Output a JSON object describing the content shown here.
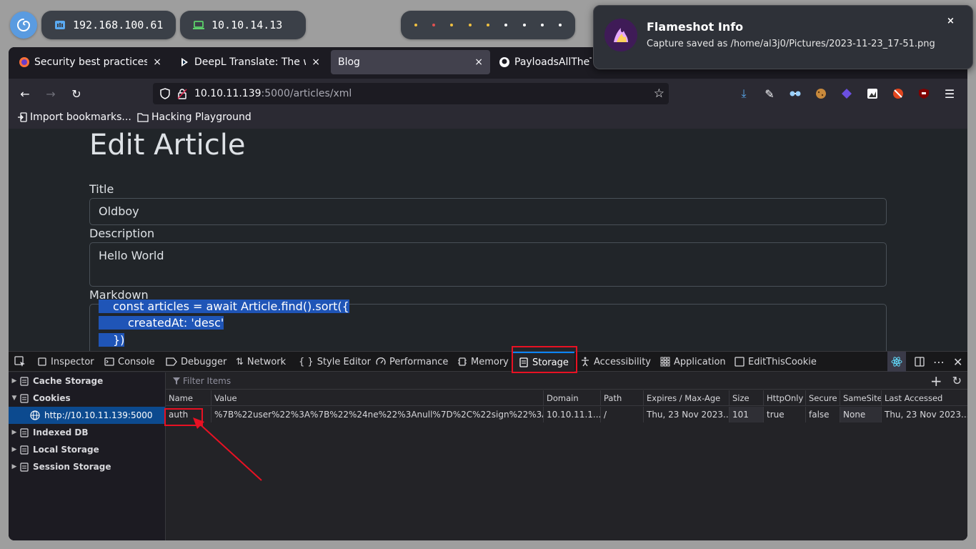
{
  "desktop": {
    "ip_pill_1": "192.168.100.61",
    "ip_pill_2": "10.10.14.13"
  },
  "browser": {
    "tabs": [
      {
        "label": "Security best practices |",
        "close": "×"
      },
      {
        "label": "DeepL Translate: The wo",
        "close": "×"
      },
      {
        "label": "Blog",
        "close": "×"
      },
      {
        "label": "PayloadsAllTheTh"
      }
    ],
    "url_host": "10.10.11.139",
    "url_path": ":5000/articles/xml",
    "bookmarks": [
      "Import bookmarks...",
      "Hacking Playground"
    ]
  },
  "page": {
    "heading": "Edit Article",
    "title_label": "Title",
    "title_value": "Oldboy",
    "description_label": "Description",
    "description_value": "Hello World",
    "markdown_label": "Markdown",
    "markdown_lines": [
      "const articles = await Article.find().sort({",
      "createdAt: 'desc'",
      "})"
    ]
  },
  "devtools": {
    "tabs": [
      "Inspector",
      "Console",
      "Debugger",
      "Network",
      "Style Editor",
      "Performance",
      "Memory",
      "Storage",
      "Accessibility",
      "Application",
      "EditThisCookie"
    ],
    "sidebar": [
      "Cache Storage",
      "Cookies",
      "http://10.10.11.139:5000",
      "Indexed DB",
      "Local Storage",
      "Session Storage"
    ],
    "filter_placeholder": "Filter Items",
    "columns": [
      "Name",
      "Value",
      "Domain",
      "Path",
      "Expires / Max-Age",
      "Size",
      "HttpOnly",
      "Secure",
      "SameSite",
      "Last Accessed"
    ],
    "row": [
      "auth",
      "%7B%22user%22%3A%7B%22%24ne%22%3Anull%7D%2C%22sign%22%3A%...",
      "10.10.11.1...",
      "/",
      "Thu, 23 Nov 2023...",
      "101",
      "true",
      "false",
      "None",
      "Thu, 23 Nov 2023..."
    ]
  },
  "notification": {
    "title": "Flameshot Info",
    "body": "Capture saved as /home/al3j0/Pictures/2023-11-23_17-51.png",
    "close": "×"
  },
  "colors": {
    "highlight": "#e81123",
    "selection": "#1f55b7",
    "accent": "#0a84ff"
  }
}
